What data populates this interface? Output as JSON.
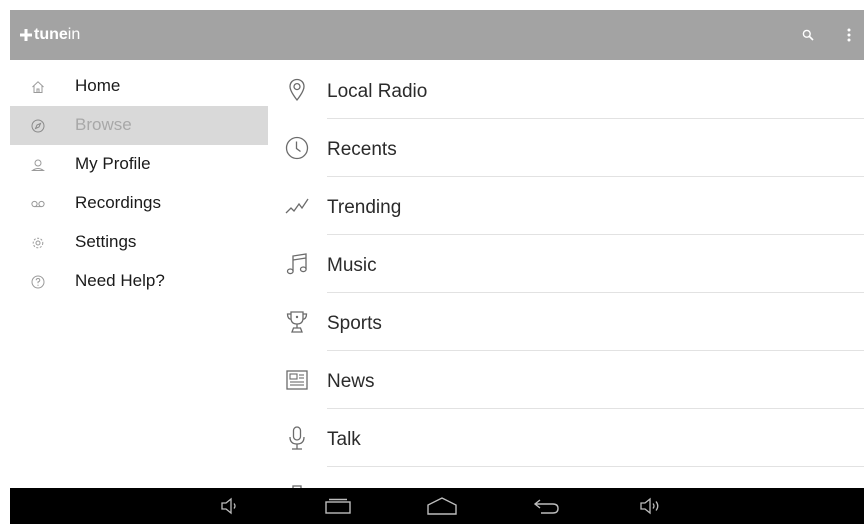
{
  "appbar": {
    "logo_part1": "tune",
    "logo_part2": "in",
    "background": "#a3a3a3"
  },
  "sidebar": {
    "items": [
      {
        "label": "Home",
        "icon": "home-icon",
        "active": false
      },
      {
        "label": "Browse",
        "icon": "compass-icon",
        "active": true
      },
      {
        "label": "My Profile",
        "icon": "profile-icon",
        "active": false
      },
      {
        "label": "Recordings",
        "icon": "recordings-icon",
        "active": false
      },
      {
        "label": "Settings",
        "icon": "settings-icon",
        "active": false
      },
      {
        "label": "Need Help?",
        "icon": "help-icon",
        "active": false
      }
    ]
  },
  "browse_list": {
    "items": [
      {
        "label": "Local Radio",
        "icon": "location-pin-icon"
      },
      {
        "label": "Recents",
        "icon": "clock-icon"
      },
      {
        "label": "Trending",
        "icon": "trending-icon"
      },
      {
        "label": "Music",
        "icon": "music-note-icon"
      },
      {
        "label": "Sports",
        "icon": "trophy-icon"
      },
      {
        "label": "News",
        "icon": "newspaper-icon"
      },
      {
        "label": "Talk",
        "icon": "microphone-icon"
      }
    ]
  },
  "system_nav": {
    "buttons": [
      "volume-down-icon",
      "recent-apps-icon",
      "home-nav-icon",
      "back-icon",
      "volume-up-icon"
    ]
  }
}
